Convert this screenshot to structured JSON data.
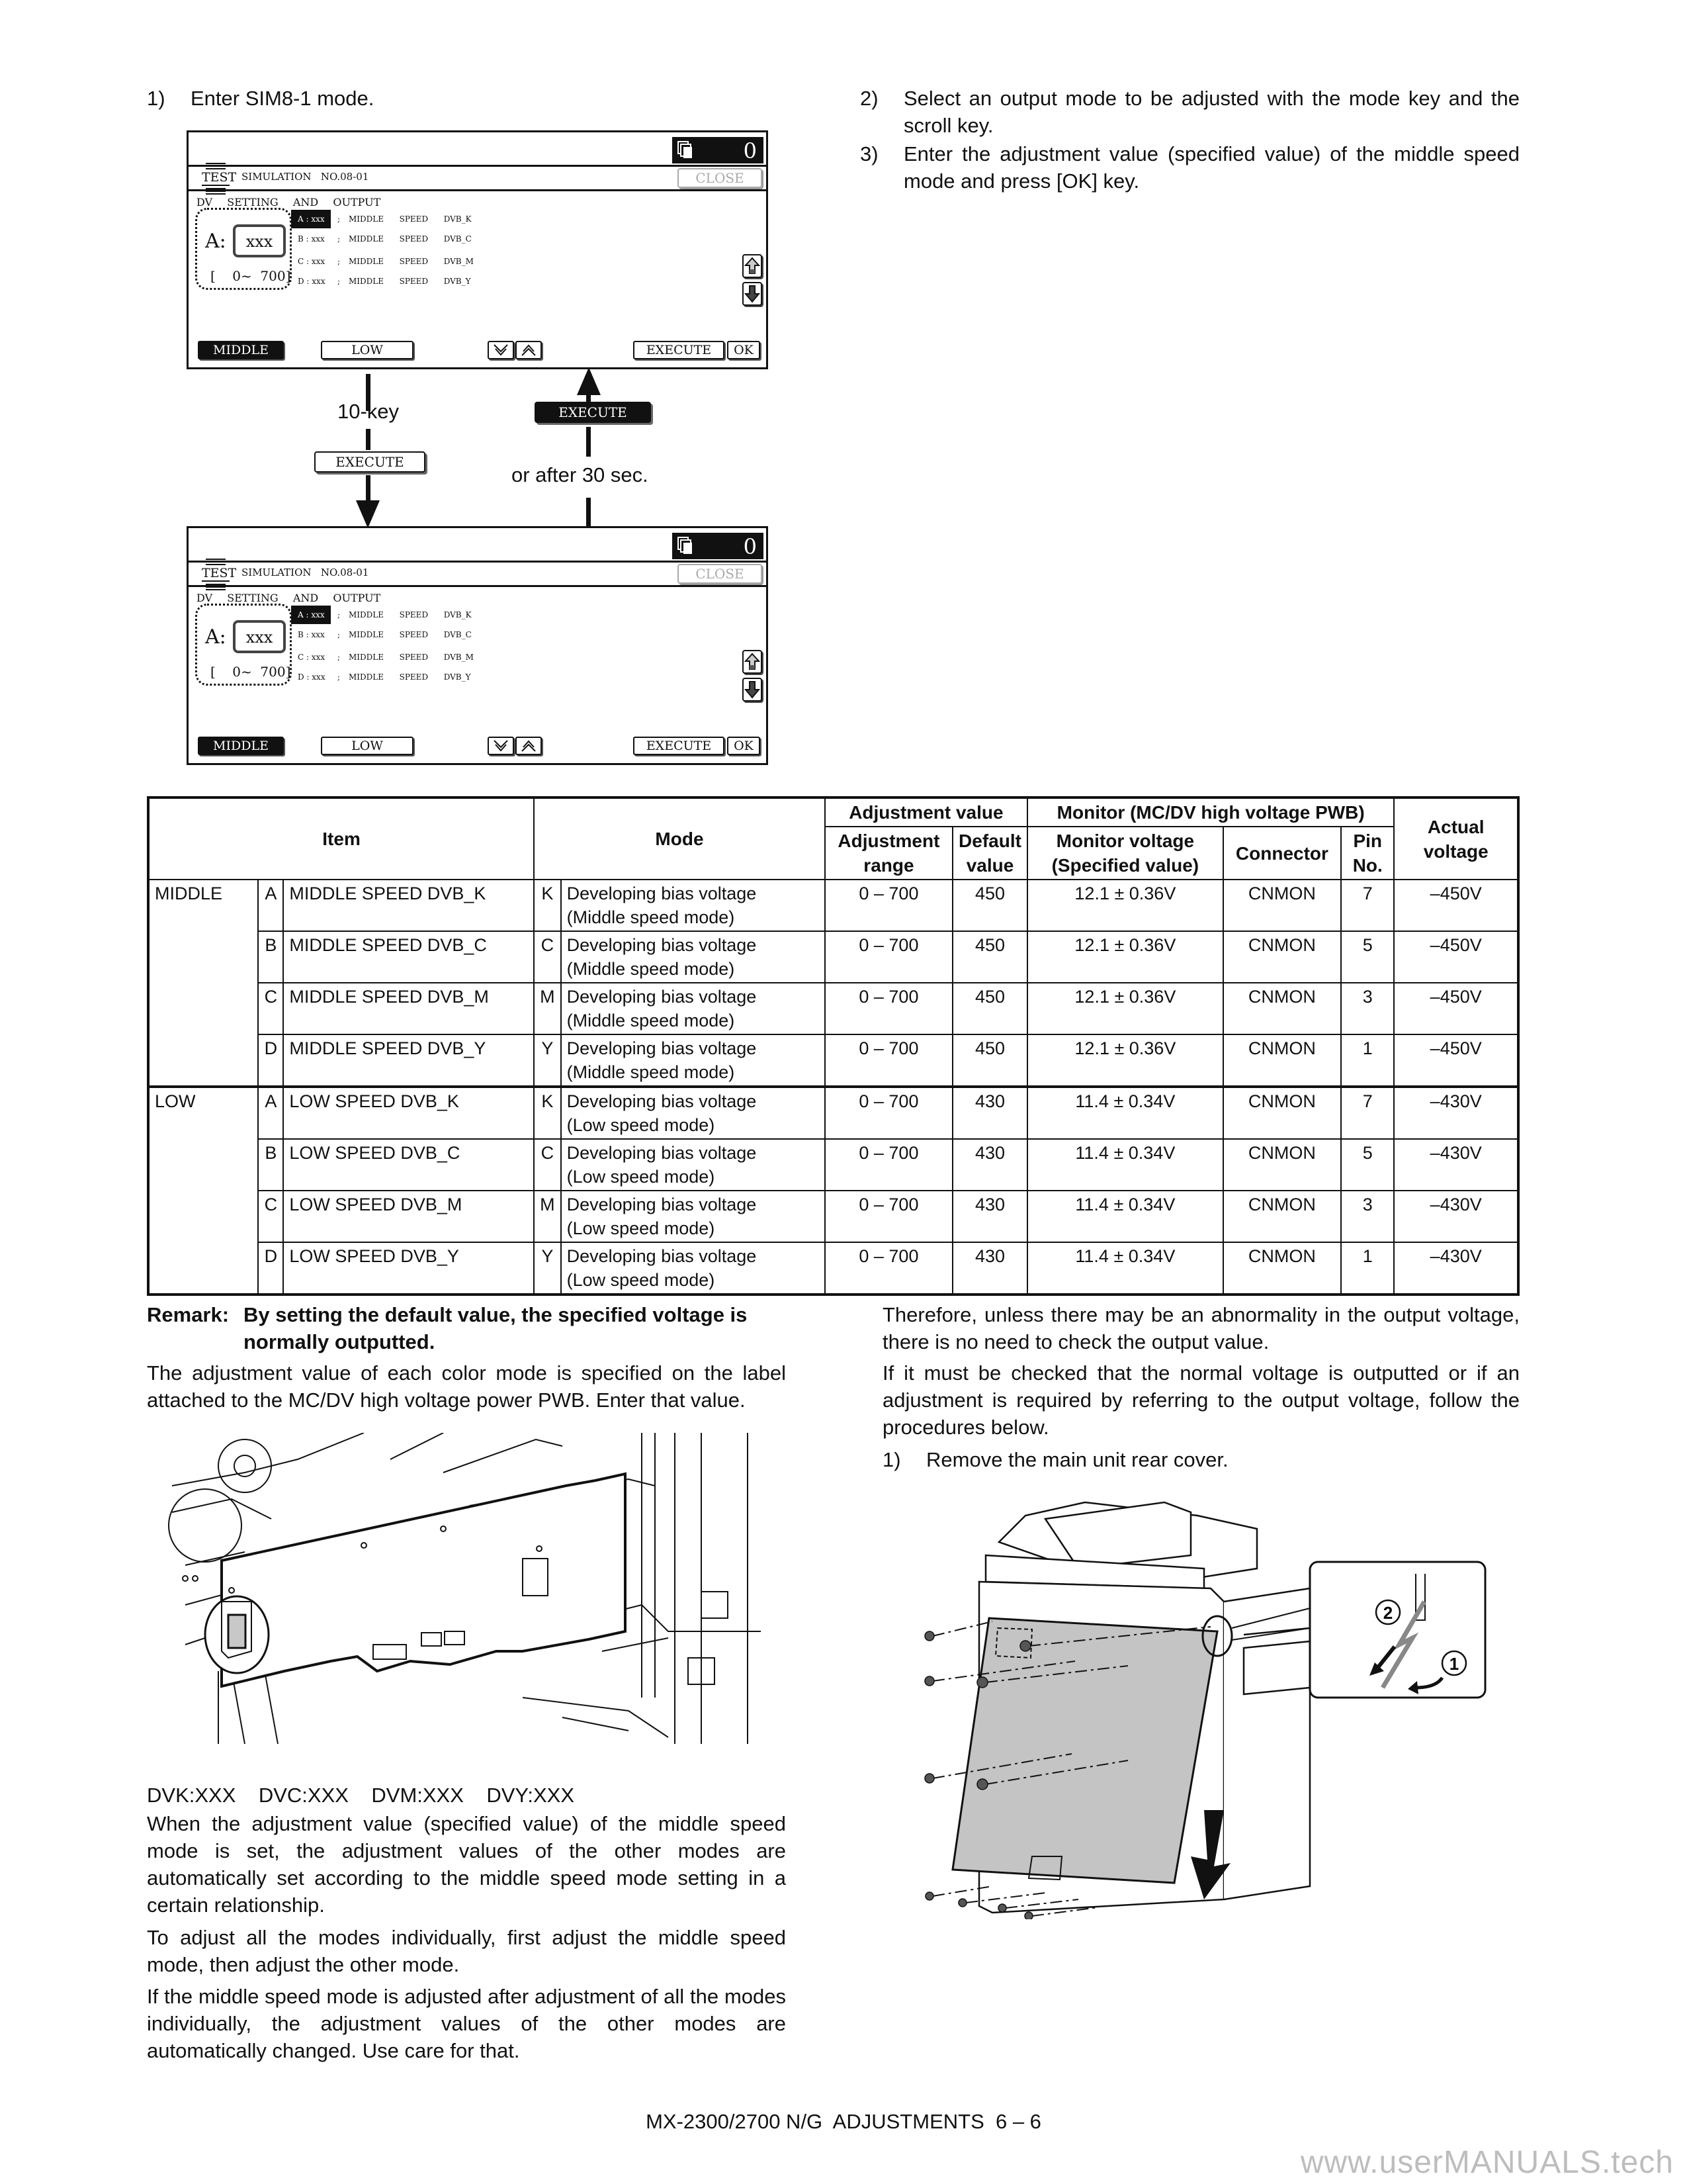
{
  "left_column": {
    "step1": {
      "num": "1)",
      "text": "Enter SIM8-1 mode."
    }
  },
  "right_column": {
    "steps": [
      {
        "num": "2)",
        "text": "Select an output mode to be adjusted with the mode key and the scroll key."
      },
      {
        "num": "3)",
        "text": "Enter the adjustment value (specified value) of the middle speed mode and press [OK] key."
      }
    ]
  },
  "sim_screen": {
    "copy_count": "0",
    "test_label": "TEST",
    "title": "SIMULATION   NO.08-01",
    "close_label": "CLOSE",
    "section_label": "DV  SETTING  AND  OUTPUT",
    "current_channel": "A:",
    "current_value": "xxx",
    "range": "[    0~  700]",
    "rows": [
      {
        "key": "A : xxx",
        "sep": ";",
        "desc": "MIDDLE  SPEED  DVB_K",
        "selected": true
      },
      {
        "key": "B : xxx",
        "sep": ";",
        "desc": "MIDDLE  SPEED  DVB_C",
        "selected": false
      },
      {
        "key": "C : xxx",
        "sep": ";",
        "desc": "MIDDLE  SPEED  DVB_M",
        "selected": false
      },
      {
        "key": "D : xxx",
        "sep": ";",
        "desc": "MIDDLE  SPEED  DVB_Y",
        "selected": false
      }
    ],
    "mode_buttons": [
      "MIDDLE",
      "LOW"
    ],
    "active_mode": "MIDDLE",
    "execute_label": "EXECUTE",
    "ok_label": "OK"
  },
  "flow": {
    "left_label": "10-key",
    "left_button": "EXECUTE",
    "right_button": "EXECUTE",
    "right_label": "or after 30 sec."
  },
  "table": {
    "headers": {
      "item": "Item",
      "mode": "Mode",
      "adjustment_value": "Adjustment value",
      "monitor": "Monitor (MC/DV high voltage PWB)",
      "actual_voltage": "Actual voltage",
      "adjustment_range": "Adjustment range",
      "default_value": "Default value",
      "monitor_voltage": "Monitor voltage (Specified value)",
      "connector": "Connector",
      "pin_no": "Pin No."
    },
    "groups": [
      {
        "group": "MIDDLE",
        "rows": [
          {
            "key": "A",
            "item": "MIDDLE SPEED DVB_K",
            "color": "K",
            "mode_line1": "Developing bias voltage",
            "mode_line2": "(Middle speed mode)",
            "range": "0 – 700",
            "default": "450",
            "monitor_voltage": "12.1 ± 0.36V",
            "connector": "CNMON",
            "pin": "7",
            "actual": "–450V"
          },
          {
            "key": "B",
            "item": "MIDDLE SPEED DVB_C",
            "color": "C",
            "mode_line1": "Developing bias voltage",
            "mode_line2": "(Middle speed mode)",
            "range": "0 – 700",
            "default": "450",
            "monitor_voltage": "12.1 ± 0.36V",
            "connector": "CNMON",
            "pin": "5",
            "actual": "–450V"
          },
          {
            "key": "C",
            "item": "MIDDLE SPEED DVB_M",
            "color": "M",
            "mode_line1": "Developing bias voltage",
            "mode_line2": "(Middle speed mode)",
            "range": "0 – 700",
            "default": "450",
            "monitor_voltage": "12.1 ± 0.36V",
            "connector": "CNMON",
            "pin": "3",
            "actual": "–450V"
          },
          {
            "key": "D",
            "item": "MIDDLE SPEED DVB_Y",
            "color": "Y",
            "mode_line1": "Developing bias voltage",
            "mode_line2": "(Middle speed mode)",
            "range": "0 – 700",
            "default": "450",
            "monitor_voltage": "12.1 ± 0.36V",
            "connector": "CNMON",
            "pin": "1",
            "actual": "–450V"
          }
        ]
      },
      {
        "group": "LOW",
        "rows": [
          {
            "key": "A",
            "item": "LOW SPEED DVB_K",
            "color": "K",
            "mode_line1": "Developing bias voltage",
            "mode_line2": "(Low speed mode)",
            "range": "0 – 700",
            "default": "430",
            "monitor_voltage": "11.4 ± 0.34V",
            "connector": "CNMON",
            "pin": "7",
            "actual": "–430V"
          },
          {
            "key": "B",
            "item": "LOW SPEED DVB_C",
            "color": "C",
            "mode_line1": "Developing bias voltage",
            "mode_line2": "(Low speed mode)",
            "range": "0 – 700",
            "default": "430",
            "monitor_voltage": "11.4 ± 0.34V",
            "connector": "CNMON",
            "pin": "5",
            "actual": "–430V"
          },
          {
            "key": "C",
            "item": "LOW SPEED DVB_M",
            "color": "M",
            "mode_line1": "Developing bias voltage",
            "mode_line2": "(Low speed mode)",
            "range": "0 – 700",
            "default": "430",
            "monitor_voltage": "11.4 ± 0.34V",
            "connector": "CNMON",
            "pin": "3",
            "actual": "–430V"
          },
          {
            "key": "D",
            "item": "LOW SPEED DVB_Y",
            "color": "Y",
            "mode_line1": "Developing bias voltage",
            "mode_line2": "(Low speed mode)",
            "range": "0 – 700",
            "default": "430",
            "monitor_voltage": "11.4 ± 0.34V",
            "connector": "CNMON",
            "pin": "1",
            "actual": "–430V"
          }
        ]
      }
    ]
  },
  "remark": {
    "label": "Remark:",
    "text": "By setting the default value, the specified voltage is normally outputted."
  },
  "left_paragraphs": {
    "label_intro": "The adjustment value of each color mode is specified on the label attached to the MC/DV high voltage power PWB. Enter that value.",
    "label_values": "DVK:XXX    DVC:XXX    DVM:XXX    DVY:XXX",
    "p1": "When the adjustment value (specified value) of the middle speed mode is set, the adjustment values of the other modes are automatically set according to the middle speed mode setting in a certain relationship.",
    "p2": "To adjust all the modes individually, first adjust the middle speed mode, then adjust the other mode.",
    "p3": "If the middle speed mode is adjusted after adjustment of all the modes individually, the adjustment values of the other modes are automatically changed. Use care for that."
  },
  "right_paragraphs": {
    "p1": "Therefore, unless there may be an abnormality in the output voltage, there is no need to check the output value.",
    "p2": "If it must be checked that the normal voltage is outputted or if an adjustment is required by referring to the output voltage, follow the procedures below.",
    "step1_num": "1)",
    "step1_text": "Remove the main unit rear cover."
  },
  "rear_cover_illustration": {
    "callouts": [
      "1",
      "2"
    ]
  },
  "footer": {
    "text": "MX-2300/2700 N/G  ADJUSTMENTS  6 – 6",
    "watermark": "www.userMANUALS.tech"
  }
}
